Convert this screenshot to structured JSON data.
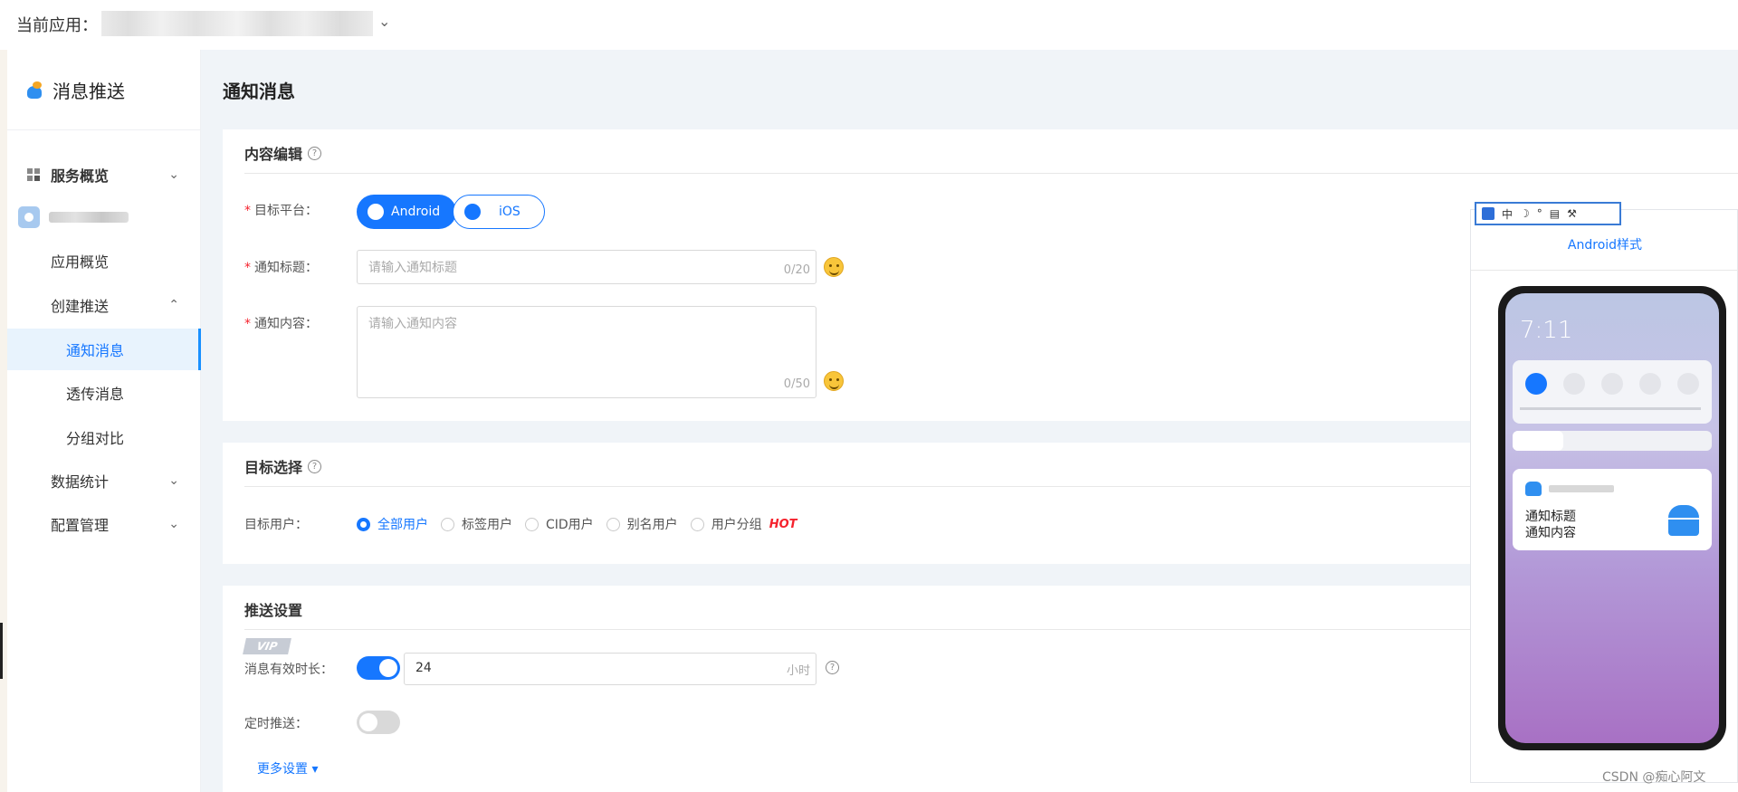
{
  "topbar": {
    "current_app_label": "当前应用："
  },
  "sidebar": {
    "brand": "消息推送",
    "items": [
      {
        "label": "服务概览"
      },
      {
        "label": "应用概览"
      },
      {
        "label": "创建推送"
      },
      {
        "label": "通知消息"
      },
      {
        "label": "透传消息"
      },
      {
        "label": "分组对比"
      },
      {
        "label": "数据统计"
      },
      {
        "label": "配置管理"
      }
    ]
  },
  "main": {
    "page_title": "通知消息",
    "content_edit": {
      "title": "内容编辑",
      "platform_label": "目标平台：",
      "platforms": [
        "Android",
        "iOS"
      ],
      "notif_title_label": "通知标题：",
      "notif_title_placeholder": "请输入通知标题",
      "notif_title_count": "0/20",
      "notif_content_label": "通知内容：",
      "notif_content_placeholder": "请输入通知内容",
      "notif_content_count": "0/50"
    },
    "target": {
      "title": "目标选择",
      "user_label": "目标用户：",
      "options": [
        "全部用户",
        "标签用户",
        "CID用户",
        "别名用户",
        "用户分组"
      ],
      "hot_badge": "HOT",
      "selected_index": 0
    },
    "push_settings": {
      "title": "推送设置",
      "vip_badge": "VIP",
      "validity_label": "消息有效时长：",
      "validity_value": "24",
      "validity_unit": "小时",
      "validity_enabled": true,
      "schedule_label": "定时推送：",
      "schedule_enabled": false,
      "more_settings": "更多设置 ▾"
    }
  },
  "preview": {
    "title": "Android样式",
    "time": "7:11",
    "notification_title": "通知标题",
    "notification_content": "通知内容",
    "ime_label": "中"
  },
  "watermark": "CSDN @痴心阿文",
  "colors": {
    "accent": "#1677ff",
    "required": "#f5222d",
    "background": "#f0f4f8"
  }
}
